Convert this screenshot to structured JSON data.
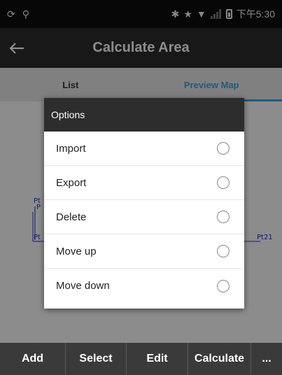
{
  "status_bar": {
    "left_icons": [
      "refresh-icon",
      "usb-icon"
    ],
    "right_icons": [
      "bluetooth-icon",
      "star-icon",
      "wifi-icon",
      "signal-icon",
      "battery-icon"
    ],
    "time": "下午5:30"
  },
  "app_bar": {
    "title": "Calculate Area",
    "back_icon": "arrow-left-icon"
  },
  "tabs": [
    {
      "label": "List",
      "active": false
    },
    {
      "label": "Preview Map",
      "active": true
    }
  ],
  "map": {
    "labels": [
      "Pt",
      "P",
      "Pt",
      "Pt21"
    ]
  },
  "dialog": {
    "title": "Options",
    "options": [
      {
        "label": "Import",
        "selected": false
      },
      {
        "label": "Export",
        "selected": false
      },
      {
        "label": "Delete",
        "selected": false
      },
      {
        "label": "Move up",
        "selected": false
      },
      {
        "label": "Move down",
        "selected": false
      }
    ]
  },
  "toolbar": {
    "buttons": [
      "Add",
      "Select",
      "Edit",
      "Calculate",
      "..."
    ]
  },
  "colors": {
    "accent": "#3aa6e0",
    "app_bar": "#2d2d2d",
    "status_bar": "#0d0d0d",
    "toolbar": "#3a3a3a",
    "map_points": "#2233cc"
  }
}
